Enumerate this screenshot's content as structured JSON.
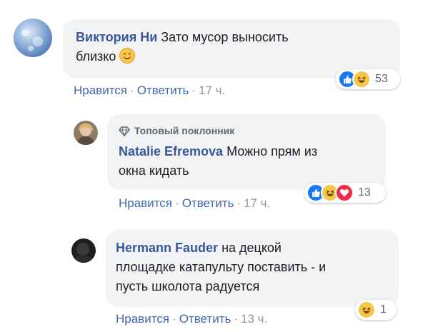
{
  "comments": [
    {
      "author": "Виктория Ни",
      "text_line1": "Зато мусор выносить",
      "text_line2": "близко",
      "reaction_count": "53",
      "actions": {
        "like": "Нравится",
        "reply": "Ответить",
        "time": "17 ч."
      }
    },
    {
      "badge": "Топовый поклонник",
      "author": "Natalie Efremova",
      "text_line1": "Можно прям из",
      "text_line2": "окна кидать",
      "reaction_count": "13",
      "actions": {
        "like": "Нравится",
        "reply": "Ответить",
        "time": "17 ч."
      }
    },
    {
      "author": "Hermann Fauder",
      "text_line1": "на децкой",
      "text_line2": "площадке катапульту поставить - и",
      "text_line3": "пусть школота радуется",
      "reaction_count": "1",
      "actions": {
        "like": "Нравится",
        "reply": "Ответить",
        "time": "13 ч."
      }
    }
  ],
  "colors": {
    "name": "#385898",
    "link": "#4267b2",
    "bubble": "#f2f3f5",
    "like": "#1877f2",
    "haha": "#f7c74a",
    "love": "#f0284a"
  },
  "icons": [
    "avatar",
    "diamond-icon",
    "like-reaction-icon",
    "haha-reaction-icon",
    "love-reaction-icon",
    "smiling-face-emoji"
  ]
}
